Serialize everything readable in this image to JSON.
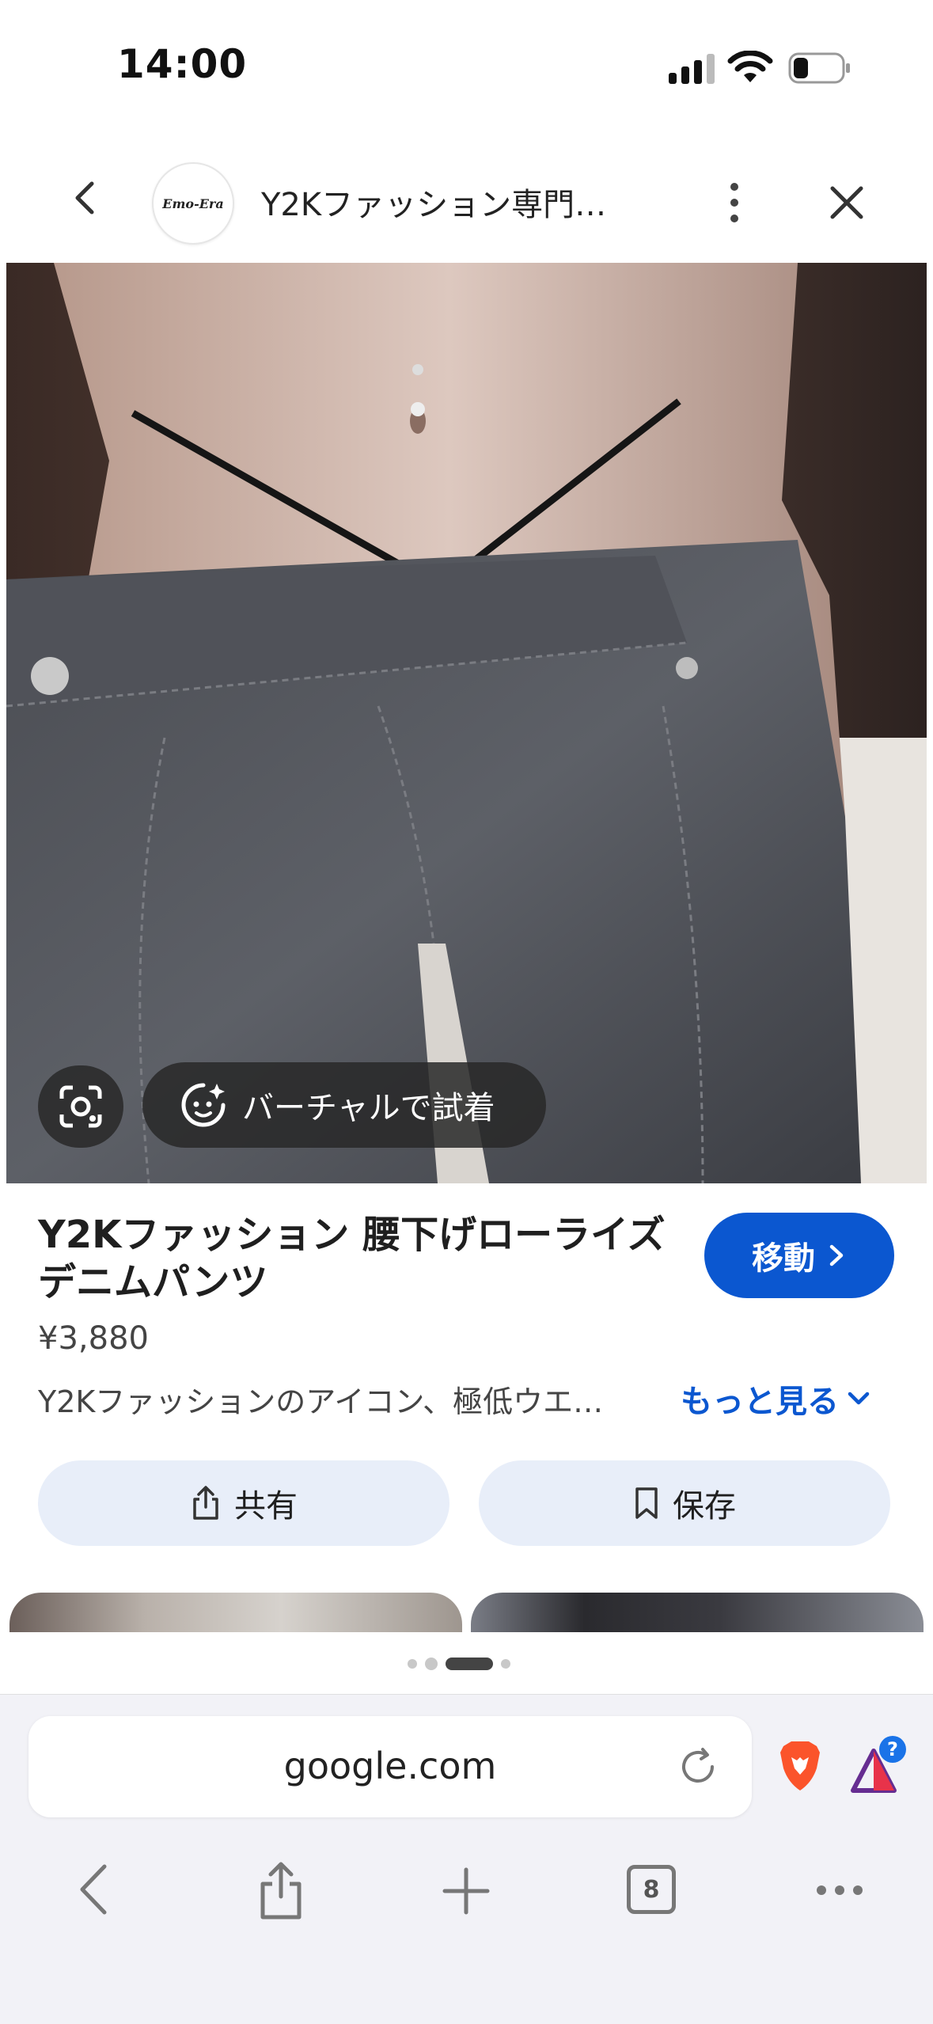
{
  "status_bar": {
    "time": "14:00"
  },
  "header": {
    "logo_text": "Emo-Era",
    "title": "Y2Kファッション専門…"
  },
  "image_overlay": {
    "try_on_label": "バーチャルで試着"
  },
  "product": {
    "title": "Y2Kファッション 腰下げローライズデニムパンツ",
    "visit_label": "移動",
    "price": "¥3,880",
    "description": "Y2Kファッションのアイコン、極低ウエ…",
    "more_label": "もっと見る"
  },
  "actions": {
    "share_label": "共有",
    "save_label": "保存"
  },
  "browser": {
    "url": "google.com",
    "tab_count": "8",
    "rewards_badge": "?"
  },
  "colors": {
    "accent": "#0b57d0",
    "pill_bg": "#e8eef9",
    "brave_orange": "#fb542b"
  }
}
